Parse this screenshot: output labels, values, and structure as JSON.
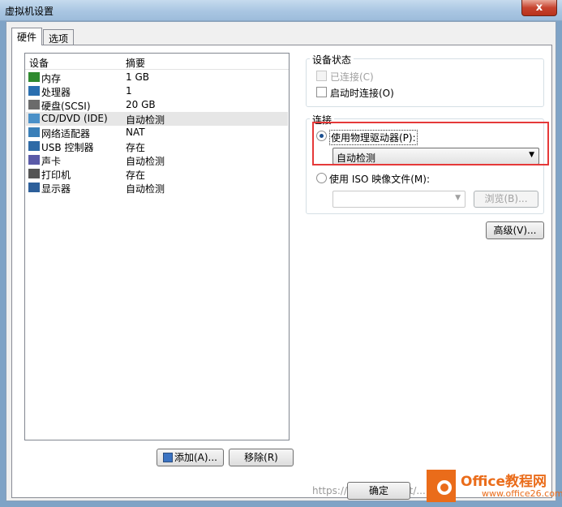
{
  "window": {
    "title": "虚拟机设置",
    "close_label": "x"
  },
  "tabs": [
    {
      "label": "硬件"
    },
    {
      "label": "选项"
    }
  ],
  "device_list": {
    "col_device": "设备",
    "col_summary": "摘要",
    "rows": [
      {
        "name": "内存",
        "summary": "1 GB",
        "icon": "memory-icon"
      },
      {
        "name": "处理器",
        "summary": "1",
        "icon": "processor-icon"
      },
      {
        "name": "硬盘(SCSI)",
        "summary": "20 GB",
        "icon": "harddisk-icon"
      },
      {
        "name": "CD/DVD (IDE)",
        "summary": "自动检测",
        "icon": "cd-dvd-icon"
      },
      {
        "name": "网络适配器",
        "summary": "NAT",
        "icon": "network-adapter-icon"
      },
      {
        "name": "USB 控制器",
        "summary": "存在",
        "icon": "usb-icon"
      },
      {
        "name": "声卡",
        "summary": "自动检测",
        "icon": "sound-card-icon"
      },
      {
        "name": "打印机",
        "summary": "存在",
        "icon": "printer-icon"
      },
      {
        "name": "显示器",
        "summary": "自动检测",
        "icon": "monitor-icon"
      }
    ]
  },
  "buttons": {
    "add": "添加(A)...",
    "remove": "移除(R)",
    "advanced": "高级(V)...",
    "browse": "浏览(B)...",
    "ok": "确定"
  },
  "device_status": {
    "title": "设备状态",
    "connected": "已连接(C)",
    "connect_at_power_on": "启动时连接(O)"
  },
  "connection": {
    "title": "连接",
    "use_physical": "使用物理驱动器(P):",
    "physical_value": "自动检测",
    "use_iso": "使用 ISO 映像文件(M):",
    "iso_value": ""
  },
  "watermark": "https://blog.csdn.net/...",
  "logo": {
    "line1": "Office教程网",
    "line2": "www.office26.com"
  },
  "colors": {
    "highlight": "#e53939",
    "logo": "#ea6c1a"
  }
}
